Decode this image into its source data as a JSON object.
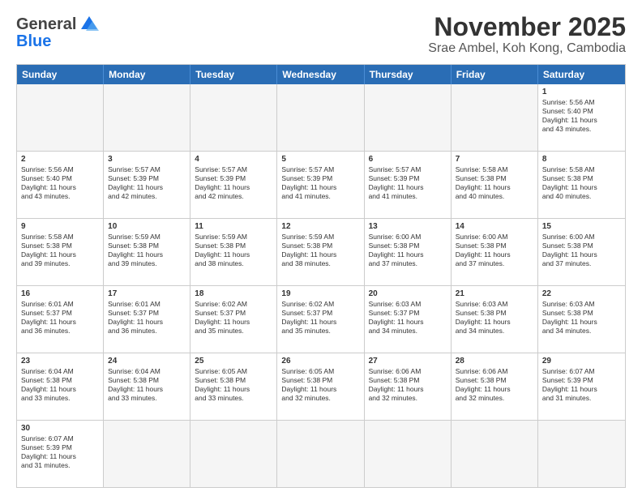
{
  "logo": {
    "line1": "General",
    "line2": "Blue"
  },
  "title": "November 2025",
  "subtitle": "Srae Ambel, Koh Kong, Cambodia",
  "header": {
    "days": [
      "Sunday",
      "Monday",
      "Tuesday",
      "Wednesday",
      "Thursday",
      "Friday",
      "Saturday"
    ]
  },
  "weeks": [
    [
      {
        "day": "",
        "info": ""
      },
      {
        "day": "",
        "info": ""
      },
      {
        "day": "",
        "info": ""
      },
      {
        "day": "",
        "info": ""
      },
      {
        "day": "",
        "info": ""
      },
      {
        "day": "",
        "info": ""
      },
      {
        "day": "1",
        "info": "Sunrise: 5:56 AM\nSunset: 5:40 PM\nDaylight: 11 hours\nand 43 minutes."
      }
    ],
    [
      {
        "day": "2",
        "info": "Sunrise: 5:56 AM\nSunset: 5:40 PM\nDaylight: 11 hours\nand 43 minutes."
      },
      {
        "day": "3",
        "info": "Sunrise: 5:57 AM\nSunset: 5:39 PM\nDaylight: 11 hours\nand 42 minutes."
      },
      {
        "day": "4",
        "info": "Sunrise: 5:57 AM\nSunset: 5:39 PM\nDaylight: 11 hours\nand 42 minutes."
      },
      {
        "day": "5",
        "info": "Sunrise: 5:57 AM\nSunset: 5:39 PM\nDaylight: 11 hours\nand 41 minutes."
      },
      {
        "day": "6",
        "info": "Sunrise: 5:57 AM\nSunset: 5:39 PM\nDaylight: 11 hours\nand 41 minutes."
      },
      {
        "day": "7",
        "info": "Sunrise: 5:58 AM\nSunset: 5:38 PM\nDaylight: 11 hours\nand 40 minutes."
      },
      {
        "day": "8",
        "info": "Sunrise: 5:58 AM\nSunset: 5:38 PM\nDaylight: 11 hours\nand 40 minutes."
      }
    ],
    [
      {
        "day": "9",
        "info": "Sunrise: 5:58 AM\nSunset: 5:38 PM\nDaylight: 11 hours\nand 39 minutes."
      },
      {
        "day": "10",
        "info": "Sunrise: 5:59 AM\nSunset: 5:38 PM\nDaylight: 11 hours\nand 39 minutes."
      },
      {
        "day": "11",
        "info": "Sunrise: 5:59 AM\nSunset: 5:38 PM\nDaylight: 11 hours\nand 38 minutes."
      },
      {
        "day": "12",
        "info": "Sunrise: 5:59 AM\nSunset: 5:38 PM\nDaylight: 11 hours\nand 38 minutes."
      },
      {
        "day": "13",
        "info": "Sunrise: 6:00 AM\nSunset: 5:38 PM\nDaylight: 11 hours\nand 37 minutes."
      },
      {
        "day": "14",
        "info": "Sunrise: 6:00 AM\nSunset: 5:38 PM\nDaylight: 11 hours\nand 37 minutes."
      },
      {
        "day": "15",
        "info": "Sunrise: 6:00 AM\nSunset: 5:38 PM\nDaylight: 11 hours\nand 37 minutes."
      }
    ],
    [
      {
        "day": "16",
        "info": "Sunrise: 6:01 AM\nSunset: 5:37 PM\nDaylight: 11 hours\nand 36 minutes."
      },
      {
        "day": "17",
        "info": "Sunrise: 6:01 AM\nSunset: 5:37 PM\nDaylight: 11 hours\nand 36 minutes."
      },
      {
        "day": "18",
        "info": "Sunrise: 6:02 AM\nSunset: 5:37 PM\nDaylight: 11 hours\nand 35 minutes."
      },
      {
        "day": "19",
        "info": "Sunrise: 6:02 AM\nSunset: 5:37 PM\nDaylight: 11 hours\nand 35 minutes."
      },
      {
        "day": "20",
        "info": "Sunrise: 6:03 AM\nSunset: 5:37 PM\nDaylight: 11 hours\nand 34 minutes."
      },
      {
        "day": "21",
        "info": "Sunrise: 6:03 AM\nSunset: 5:38 PM\nDaylight: 11 hours\nand 34 minutes."
      },
      {
        "day": "22",
        "info": "Sunrise: 6:03 AM\nSunset: 5:38 PM\nDaylight: 11 hours\nand 34 minutes."
      }
    ],
    [
      {
        "day": "23",
        "info": "Sunrise: 6:04 AM\nSunset: 5:38 PM\nDaylight: 11 hours\nand 33 minutes."
      },
      {
        "day": "24",
        "info": "Sunrise: 6:04 AM\nSunset: 5:38 PM\nDaylight: 11 hours\nand 33 minutes."
      },
      {
        "day": "25",
        "info": "Sunrise: 6:05 AM\nSunset: 5:38 PM\nDaylight: 11 hours\nand 33 minutes."
      },
      {
        "day": "26",
        "info": "Sunrise: 6:05 AM\nSunset: 5:38 PM\nDaylight: 11 hours\nand 32 minutes."
      },
      {
        "day": "27",
        "info": "Sunrise: 6:06 AM\nSunset: 5:38 PM\nDaylight: 11 hours\nand 32 minutes."
      },
      {
        "day": "28",
        "info": "Sunrise: 6:06 AM\nSunset: 5:38 PM\nDaylight: 11 hours\nand 32 minutes."
      },
      {
        "day": "29",
        "info": "Sunrise: 6:07 AM\nSunset: 5:39 PM\nDaylight: 11 hours\nand 31 minutes."
      }
    ],
    [
      {
        "day": "30",
        "info": "Sunrise: 6:07 AM\nSunset: 5:39 PM\nDaylight: 11 hours\nand 31 minutes."
      },
      {
        "day": "",
        "info": ""
      },
      {
        "day": "",
        "info": ""
      },
      {
        "day": "",
        "info": ""
      },
      {
        "day": "",
        "info": ""
      },
      {
        "day": "",
        "info": ""
      },
      {
        "day": "",
        "info": ""
      }
    ]
  ]
}
